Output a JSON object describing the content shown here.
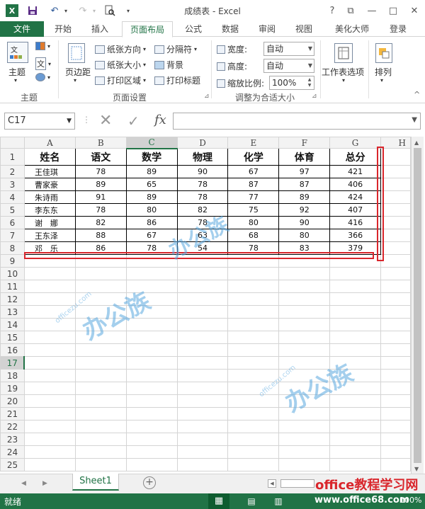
{
  "window": {
    "title": "成绩表 - Excel",
    "help": "?",
    "ribbon_display": "⧉",
    "minimize": "—",
    "maximize": "□",
    "close": "✕"
  },
  "quick_access": {
    "logo": "X",
    "save": "💾",
    "undo": "↶",
    "redo": "↷",
    "preview": "🔍",
    "dropdown": "▾"
  },
  "tabs": {
    "file": "文件",
    "home": "开始",
    "insert": "插入",
    "page_layout": "页面布局",
    "formulas": "公式",
    "data": "数据",
    "review": "审阅",
    "view": "视图",
    "beautify": "美化大师",
    "login": "登录"
  },
  "ribbon": {
    "themes": {
      "button": "主题",
      "colors_label": "",
      "fonts_label": "文",
      "effects_label": "",
      "group_label": "主题"
    },
    "page_setup": {
      "margins": "页边距",
      "orientation": "纸张方向",
      "size": "纸张大小",
      "print_area": "打印区域",
      "breaks": "分隔符",
      "background": "背景",
      "print_titles": "打印标题",
      "group_label": "页面设置"
    },
    "scale_to_fit": {
      "width_label": "宽度:",
      "width_value": "自动",
      "height_label": "高度:",
      "height_value": "自动",
      "scale_label": "缩放比例:",
      "scale_value": "100%",
      "group_label": "调整为合适大小"
    },
    "sheet_options": "工作表选项",
    "arrange": "排列",
    "collapse": "^"
  },
  "formula_bar": {
    "name_box": "C17",
    "fx": "fx",
    "cancel": "✕",
    "enter": "✓",
    "dots": "⋮",
    "value": ""
  },
  "columns": [
    "A",
    "B",
    "C",
    "D",
    "E",
    "F",
    "G",
    "H"
  ],
  "row_numbers": [
    "1",
    "2",
    "3",
    "4",
    "5",
    "6",
    "7",
    "8",
    "9",
    "10",
    "11",
    "12",
    "13",
    "14",
    "15",
    "16",
    "17",
    "18",
    "19",
    "20",
    "21",
    "22",
    "23",
    "24",
    "25"
  ],
  "table": {
    "headers": [
      "姓名",
      "语文",
      "数学",
      "物理",
      "化学",
      "体育",
      "总分"
    ],
    "rows": [
      [
        "王佳琪",
        "78",
        "89",
        "90",
        "67",
        "97",
        "421"
      ],
      [
        "曹家豪",
        "89",
        "65",
        "78",
        "87",
        "87",
        "406"
      ],
      [
        "朱诗雨",
        "91",
        "89",
        "78",
        "77",
        "89",
        "424"
      ],
      [
        "李东东",
        "78",
        "80",
        "82",
        "75",
        "92",
        "407"
      ],
      [
        "谢　娜",
        "82",
        "86",
        "78",
        "80",
        "90",
        "416"
      ],
      [
        "王东泽",
        "88",
        "67",
        "63",
        "68",
        "80",
        "366"
      ],
      [
        "邓　乐",
        "86",
        "78",
        "54",
        "78",
        "83",
        "379"
      ]
    ]
  },
  "watermark": {
    "brand": "办公族",
    "domain": "officezu.com"
  },
  "sheet_tabs": {
    "active": "Sheet1",
    "add": "+",
    "nav_left": "◀",
    "nav_right": "▶"
  },
  "site": {
    "name": "office教程学习网",
    "url": "www.office68.com"
  },
  "status": {
    "text": "就绪",
    "zoom": "100%"
  }
}
